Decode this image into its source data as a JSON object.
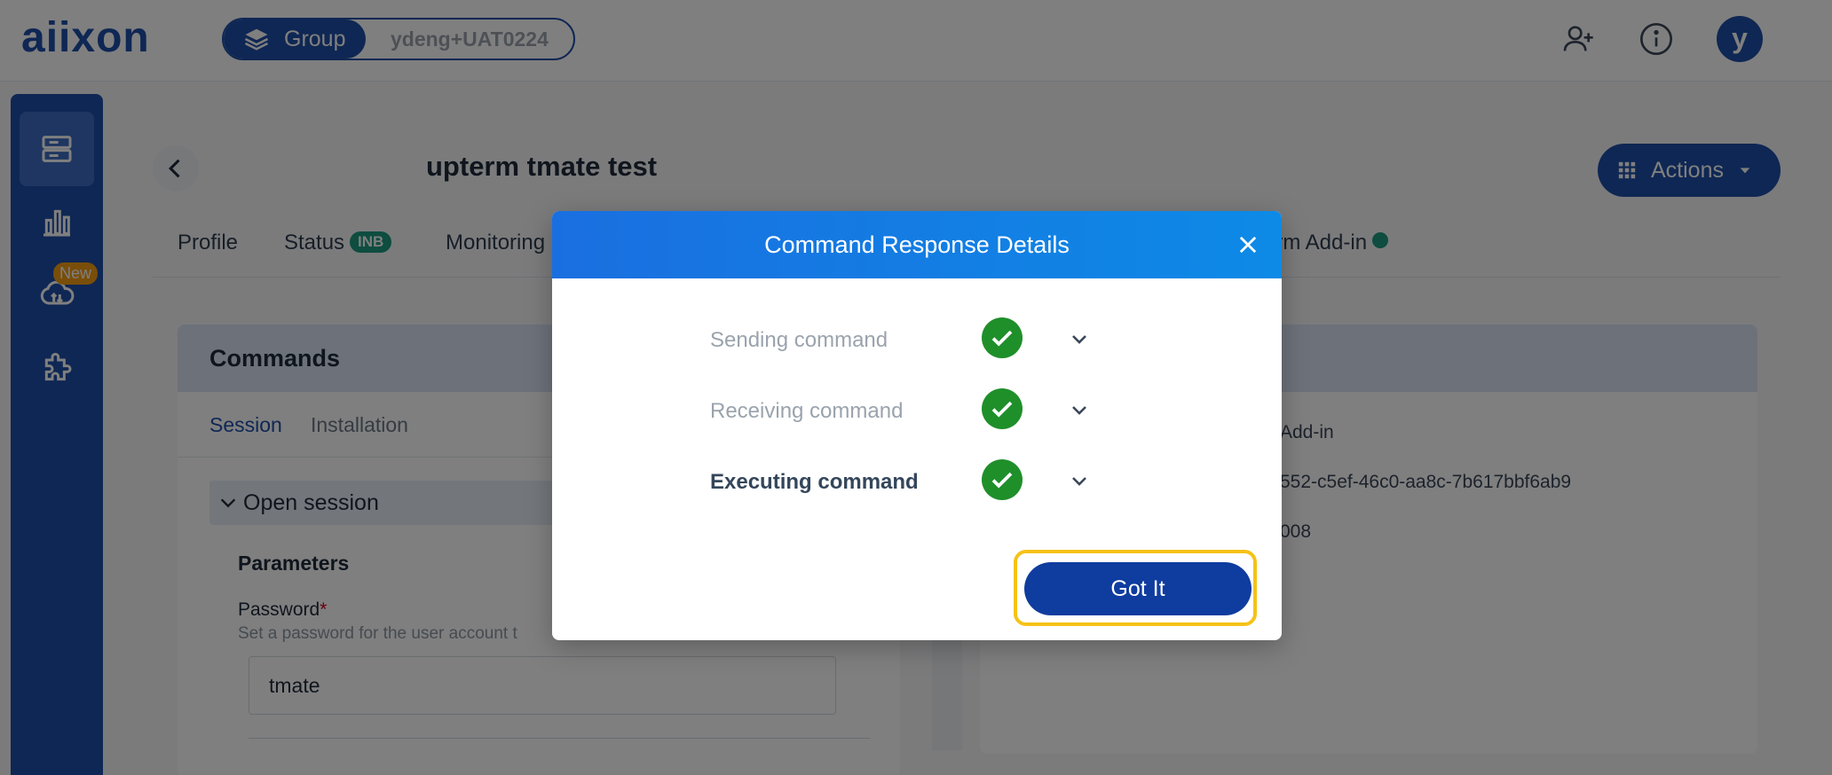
{
  "header": {
    "logo_text": "aiixon",
    "group_label": "Group",
    "account_name": "ydeng+UAT0224",
    "avatar_letter": "y"
  },
  "sidebar": {
    "new_badge": "New"
  },
  "page": {
    "title": "upterm tmate test",
    "actions_label": "Actions",
    "tabs": [
      {
        "label": "Profile"
      },
      {
        "label": "Status",
        "badge": "INB"
      },
      {
        "label": "Monitoring"
      },
      {
        "label": "erm Add-in"
      }
    ]
  },
  "commands_panel": {
    "title": "Commands",
    "subtabs": [
      "Session",
      "Installation"
    ],
    "session_row": "Open session",
    "parameters_label": "Parameters",
    "password_label": "Password",
    "password_required": "*",
    "password_help": "Set a password for the user account t",
    "password_value": "tmate"
  },
  "right_panel": {
    "lines": [
      "Add-in",
      "552-c5ef-46c0-aa8c-7b617bbf6ab9",
      "008"
    ]
  },
  "modal": {
    "title": "Command Response Details",
    "steps": [
      {
        "label": "Sending command",
        "status": "success"
      },
      {
        "label": "Receiving command",
        "status": "success"
      },
      {
        "label": "Executing command",
        "status": "success"
      }
    ],
    "confirm_label": "Got It"
  },
  "colors": {
    "brand": "#1f4fa8",
    "success": "#1f8f2a",
    "focus_ring": "#f5c218"
  }
}
